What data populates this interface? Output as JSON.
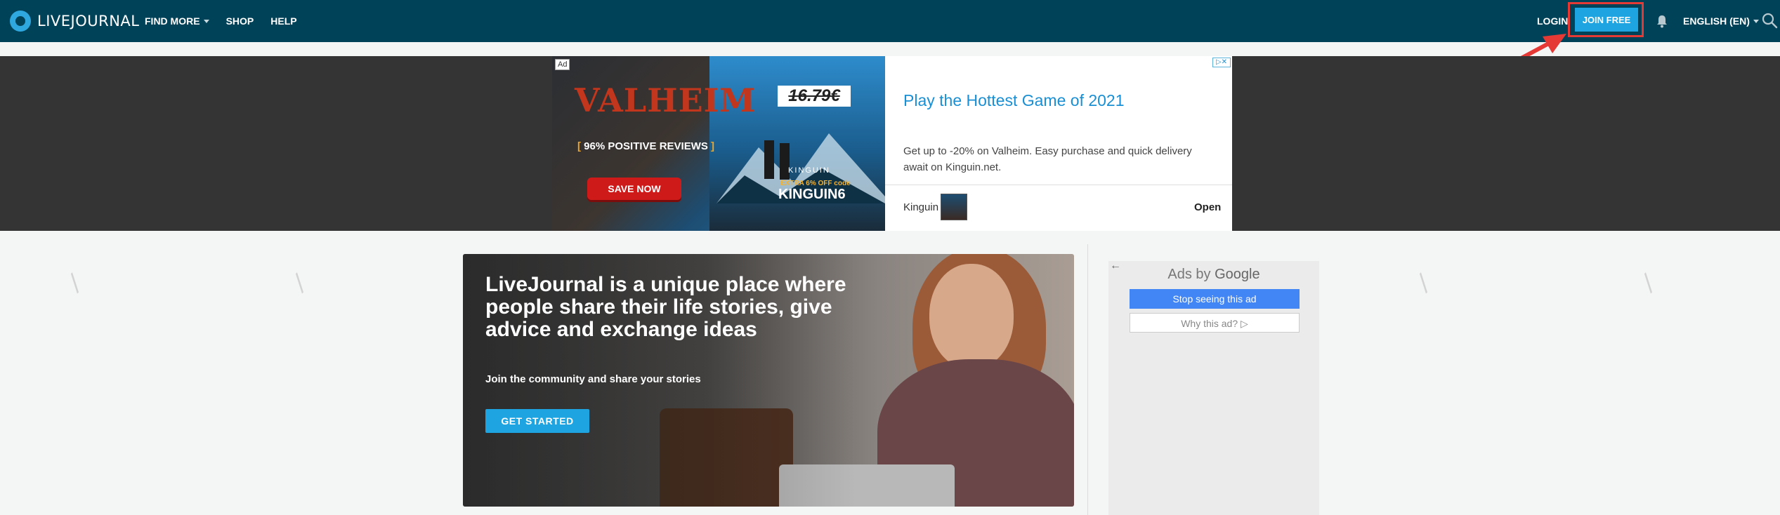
{
  "header": {
    "logo_text": "LIVEJOURNAL",
    "nav": [
      {
        "label": "FIND MORE",
        "has_dropdown": true
      },
      {
        "label": "SHOP",
        "has_dropdown": false
      },
      {
        "label": "HELP",
        "has_dropdown": false
      }
    ],
    "login_label": "LOGIN",
    "join_label": "JOIN FREE",
    "language_label": "ENGLISH (EN)",
    "icons": [
      "bell-icon",
      "search-icon"
    ]
  },
  "top_ad": {
    "tag": "Ad",
    "game_logo": "VALHEIM",
    "reviews": "96% POSITIVE REVIEWS",
    "save_label": "SAVE NOW",
    "old_price": "16.79€",
    "brand": "KINGUIN",
    "extra_offer": "EXTRA 6% OFF code",
    "promo_code": "KINGUIN6",
    "headline": "Play the Hottest Game of 2021",
    "description": "Get up to -20% on Valheim. Easy purchase and quick delivery await on Kinguin.net.",
    "advertiser": "Kinguin",
    "open_label": "Open",
    "choices_label": "▷✕"
  },
  "hero": {
    "title": "LiveJournal is a unique place where people share their life stories, give advice and exchange ideas",
    "subtitle": "Join the community and share your stories",
    "cta_label": "GET STARTED"
  },
  "side_ad": {
    "back_arrow": "←",
    "ads_by": "Ads by",
    "google": "Google",
    "stop_label": "Stop seeing this ad",
    "why_label": "Why this ad? ▷"
  },
  "colors": {
    "header_bg": "#004359",
    "accent": "#1ea5e1",
    "highlight": "#e53935",
    "ad_headline": "#1a8fd3"
  }
}
